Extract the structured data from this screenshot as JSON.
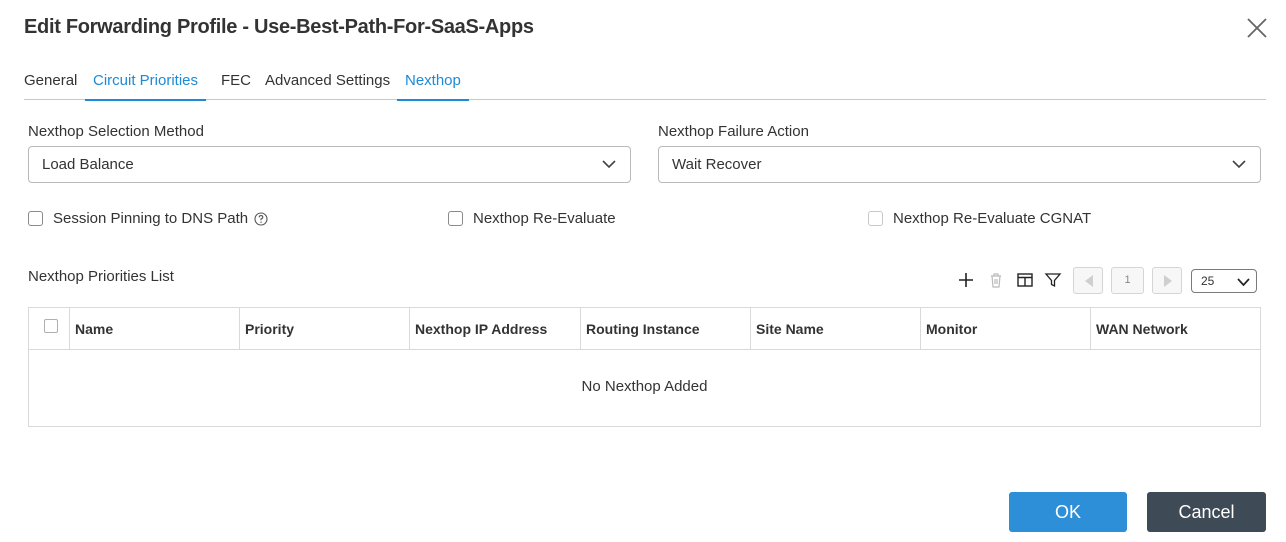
{
  "dialog": {
    "title": "Edit Forwarding Profile - Use-Best-Path-For-SaaS-Apps",
    "close_icon": "close-icon"
  },
  "tabs": [
    {
      "label": "General",
      "active": false
    },
    {
      "label": "Circuit Priorities",
      "active": true
    },
    {
      "label": "FEC",
      "active": false
    },
    {
      "label": "Advanced Settings",
      "active": false
    },
    {
      "label": "Nexthop",
      "active": true
    }
  ],
  "form": {
    "selection_method": {
      "label": "Nexthop Selection Method",
      "value": "Load Balance"
    },
    "failure_action": {
      "label": "Nexthop Failure Action",
      "value": "Wait Recover"
    },
    "checkboxes": [
      {
        "label": "Session Pinning to DNS Path",
        "checked": false,
        "help_icon": "help-circle-icon"
      },
      {
        "label": "Nexthop Re-Evaluate",
        "checked": false
      },
      {
        "label": "Nexthop Re-Evaluate CGNAT",
        "checked": false,
        "disabled": true
      }
    ]
  },
  "list": {
    "title": "Nexthop Priorities List",
    "toolbar": [
      "add-icon",
      "delete-icon",
      "columns-icon",
      "filter-icon"
    ],
    "pagination": {
      "page": "1",
      "page_size": "25"
    },
    "columns": [
      "Name",
      "Priority",
      "Nexthop IP Address",
      "Routing Instance",
      "Site Name",
      "Monitor",
      "WAN Network"
    ],
    "empty_message": "No Nexthop Added"
  },
  "footer": {
    "ok_label": "OK",
    "cancel_label": "Cancel"
  },
  "colors": {
    "accent": "#1c8ad6",
    "ok_button": "#2d8fd8",
    "cancel_button": "#3f4a57"
  }
}
